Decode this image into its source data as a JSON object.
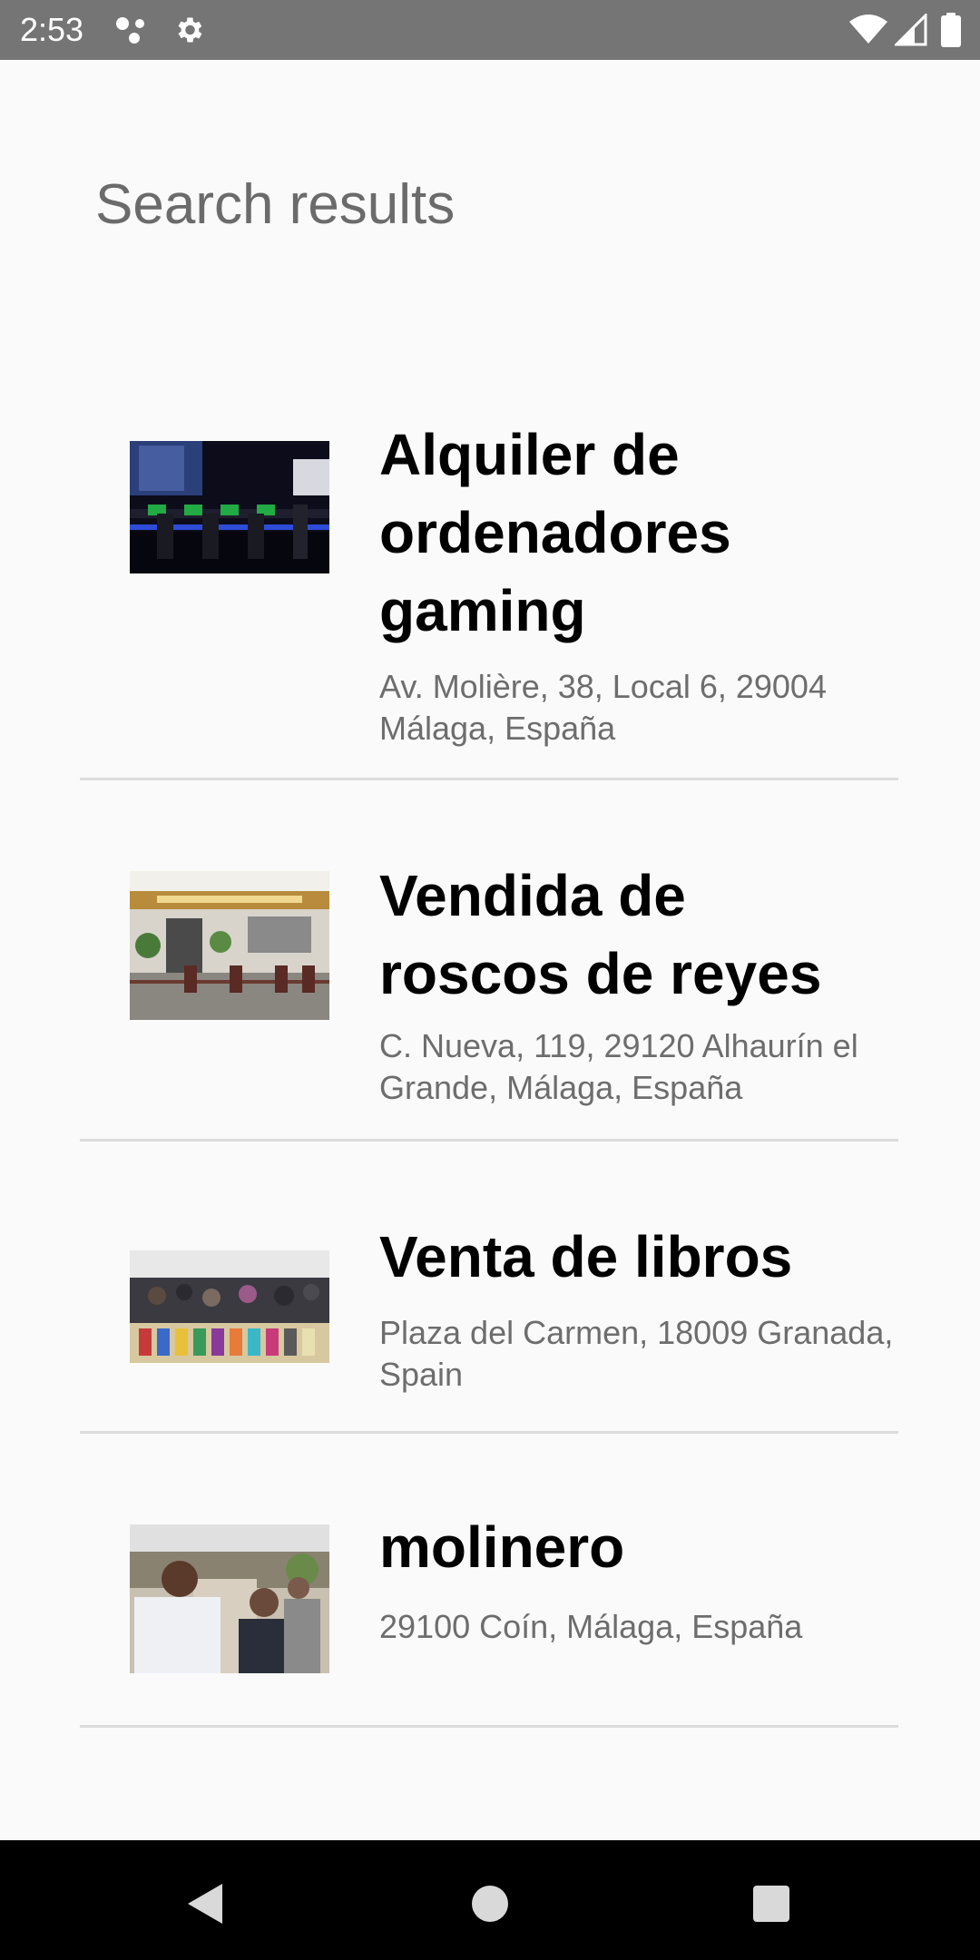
{
  "status_bar": {
    "time": "2:53",
    "icons": [
      "assistant-dots-icon",
      "settings-gear-icon",
      "wifi-icon",
      "signal-icon",
      "battery-icon"
    ]
  },
  "page": {
    "title": "Search results"
  },
  "results": [
    {
      "title": "Alquiler de ordenadores gaming",
      "address": "Av. Molière, 38, Local 6, 29004 Málaga, España"
    },
    {
      "title": "Vendida de roscos de reyes",
      "address": "C. Nueva, 119, 29120 Alhaurín el Grande, Málaga, España"
    },
    {
      "title": "Venta de libros",
      "address": "Plaza del Carmen, 18009 Granada, Spain"
    },
    {
      "title": "molinero",
      "address": "29100 Coín, Málaga, España"
    }
  ],
  "nav_bar": {
    "buttons": [
      "back-icon",
      "home-icon",
      "recents-icon"
    ]
  },
  "colors": {
    "status_bar": "#757575",
    "background": "#fafafa",
    "title": "#6b6b6b",
    "address": "#6d6d6d",
    "divider": "#dcdcdc",
    "nav_bar": "#000000"
  }
}
